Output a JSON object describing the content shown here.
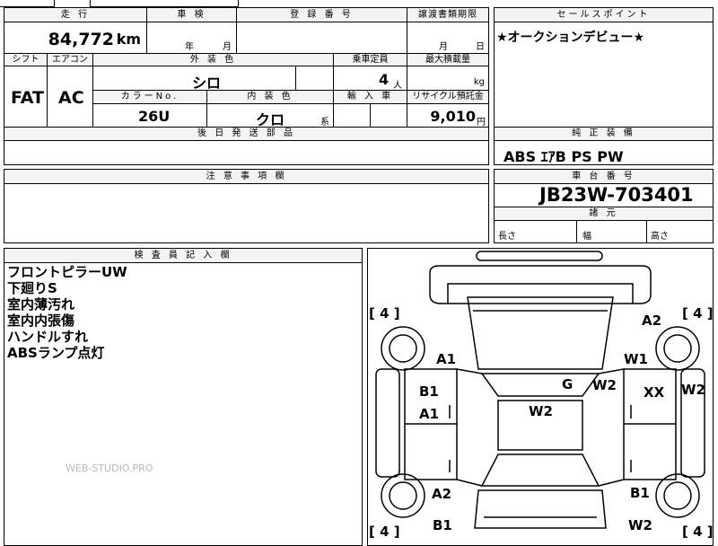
{
  "header_top": {
    "mileage_label": "走 行",
    "inspection_label": "車 検",
    "registration_label": "登 録 番 号",
    "transfer_label": "譲渡書類期限",
    "sales_point_label": "セールスポイント"
  },
  "mileage": {
    "value": "84,772",
    "unit": "km"
  },
  "inspection": {
    "year_unit": "年",
    "month_unit": "月"
  },
  "transfer": {
    "month_unit": "月",
    "day_unit": "日"
  },
  "sales_point": {
    "text": "★オークションデビュー★"
  },
  "specs": {
    "shift_label": "シフト",
    "aircon_label": "エアコン",
    "exterior_color_label": "外 装 色",
    "capacity_label": "乗車定員",
    "max_load_label": "最大積載量",
    "shift_value": "FAT",
    "aircon_value": "AC",
    "exterior_color_value": "シロ",
    "capacity_value": "4",
    "capacity_unit": "人",
    "max_load_unit": "kg",
    "color_no_label": "カラーNo.",
    "interior_color_label": "内 装 色",
    "import_label": "輸 入 車",
    "recycle_label": "リサイクル預託金",
    "color_no_value": "26U",
    "interior_color_value": "クロ",
    "interior_color_suffix": "系",
    "recycle_value": "9,010",
    "recycle_unit": "円"
  },
  "later_parts": {
    "label": "後 日 発 送 部 品"
  },
  "equipment": {
    "label": "純 正 装 備",
    "value": "ABS ｴｱB PS PW"
  },
  "caution": {
    "label": "注 意 事 項 欄"
  },
  "chassis": {
    "label": "車 台 番 号",
    "value": "JB23W-703401",
    "dims_label": "諸 元",
    "length_label": "長さ",
    "width_label": "幅",
    "height_label": "高さ"
  },
  "inspector": {
    "label": "検 査 員 記 入 欄",
    "notes": [
      "フロントピラーUW",
      "下廻りS",
      "室内薄汚れ",
      "室内内張傷",
      "ハンドルすれ",
      "ABSランプ点灯"
    ]
  },
  "watermark": "WEB-STUDIO.PRO",
  "diagram": {
    "tire_fl": "[ 4 ]",
    "tire_fr": "[ 4 ]",
    "tire_rl": "[ 4 ]",
    "tire_rr": "[ 4 ]",
    "marks": {
      "a2_right_front": "A2",
      "a1_left_front": "A1",
      "w1_right_front": "W1",
      "b1_left_door": "B1",
      "a1_left_door": "A1",
      "g_windshield": "G",
      "w2_windshield": "W2",
      "xx_right_door": "XX",
      "w2_right_side": "W2",
      "w2_roof": "W2",
      "a2_left_rear": "A2",
      "b1_right_rear": "B1",
      "b1_left_rear": "B1",
      "w2_right_rear": "W2"
    }
  }
}
